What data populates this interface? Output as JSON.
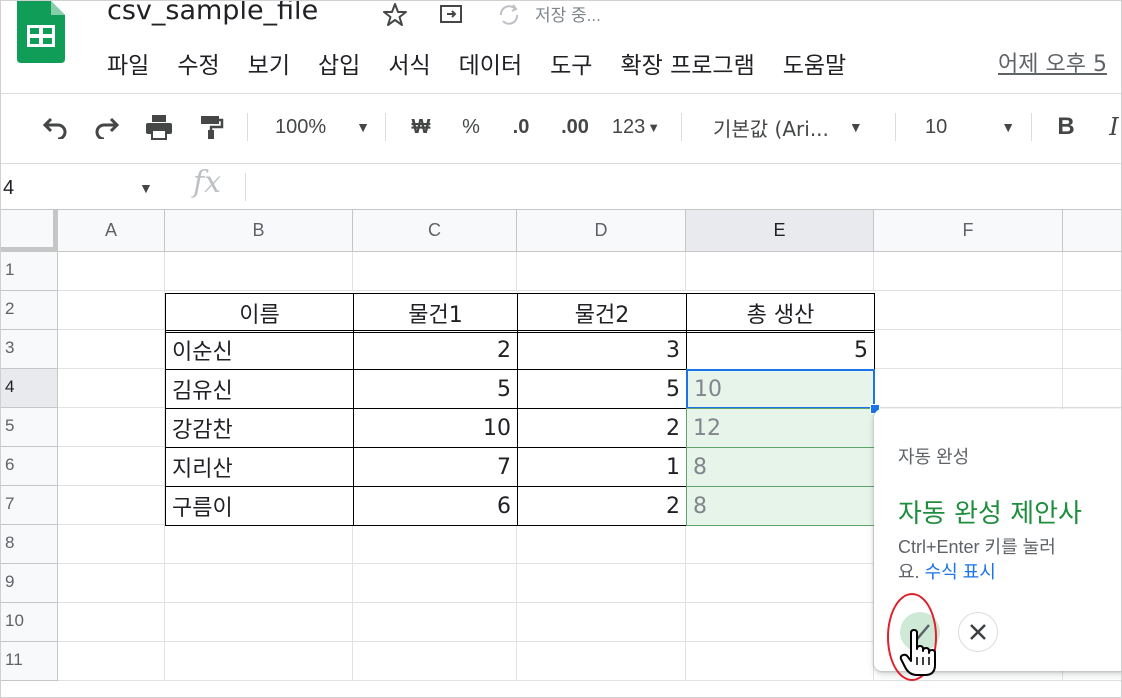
{
  "header": {
    "title": "csv_sample_file",
    "save_status": "저장 중...",
    "last_edit": "어제 오후 5",
    "menu": [
      "파일",
      "수정",
      "보기",
      "삽입",
      "서식",
      "데이터",
      "도구",
      "확장 프로그램",
      "도움말"
    ]
  },
  "toolbar": {
    "zoom": "100%",
    "currency": "₩",
    "percent": "%",
    "decrease_decimal": ".0",
    "increase_decimal": ".00",
    "number_format": "123",
    "font": "기본값 (Ari...",
    "font_size": "10",
    "bold": "B",
    "italic": "I"
  },
  "formula_bar": {
    "name_box": "4",
    "fx": "fx"
  },
  "columns": [
    "A",
    "B",
    "C",
    "D",
    "E",
    "F"
  ],
  "rows": [
    "1",
    "2",
    "3",
    "4",
    "5",
    "6",
    "7",
    "8",
    "9",
    "10",
    "11"
  ],
  "table": {
    "headers": [
      "이름",
      "물건1",
      "물건2",
      "총 생산"
    ],
    "rows": [
      {
        "name": "이순신",
        "item1": "2",
        "item2": "3",
        "total": "5"
      },
      {
        "name": "김유신",
        "item1": "5",
        "item2": "5",
        "total": "10"
      },
      {
        "name": "강감찬",
        "item1": "10",
        "item2": "2",
        "total": "12"
      },
      {
        "name": "지리산",
        "item1": "7",
        "item2": "1",
        "total": "8"
      },
      {
        "name": "구름이",
        "item1": "6",
        "item2": "2",
        "total": "8"
      }
    ]
  },
  "autocomplete": {
    "heading": "자동 완성",
    "title": "자동 완성 제안사",
    "desc_line1": "Ctrl+Enter 키를 눌러 ",
    "desc_line2_prefix": "요. ",
    "desc_link": "수식 표시"
  },
  "colors": {
    "brand_green": "#0f9d58",
    "suggestion_fill": "#e6f4ea",
    "selection_blue": "#1a73e8",
    "annotation_red": "#e0202a"
  }
}
